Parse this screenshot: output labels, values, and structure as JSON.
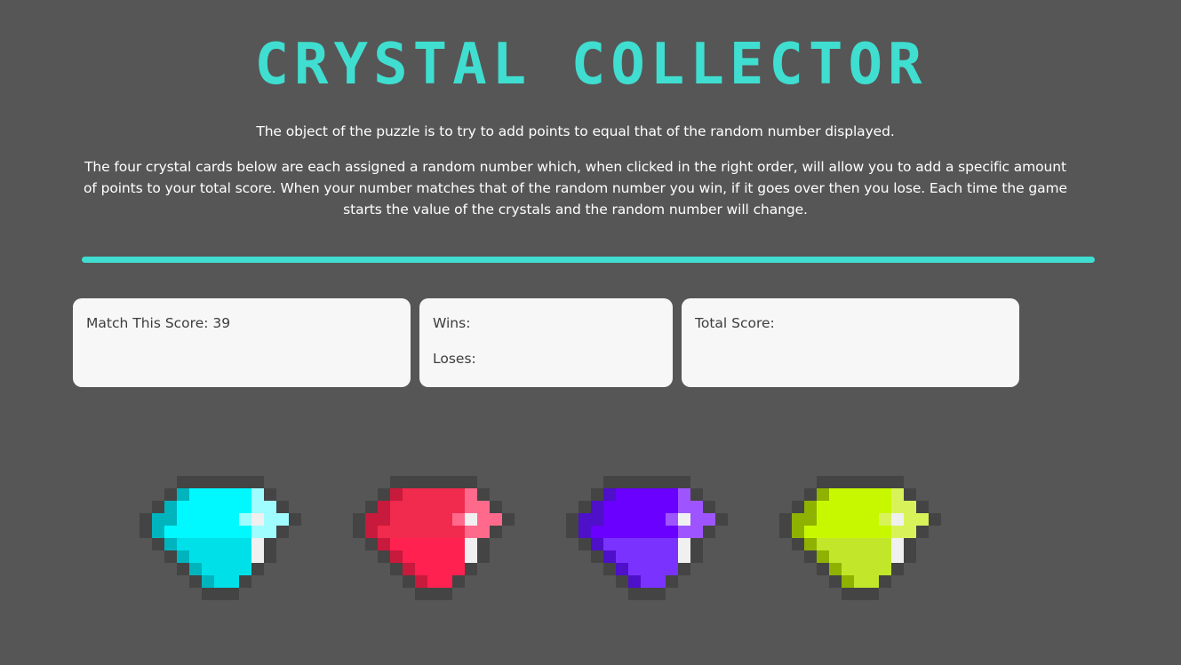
{
  "title": "CRYSTAL COLLECTOR",
  "instructions": {
    "line1": "The object of the puzzle is to try to add points to equal that of the random number displayed.",
    "line2": "The four crystal cards below are each assigned a random number which, when clicked in the right order, will allow you to add a specific amount of points to your total score. When your number matches that of the random number you win, if it goes over then you lose. Each time the game starts the value of the crystals and the random number will change."
  },
  "scoreboard": {
    "target_label": "Match This Score: 39",
    "wins_label": "Wins:",
    "losses_label": "Loses:",
    "total_label": "Total Score:"
  },
  "colors": {
    "background": "#565656",
    "accent": "#3fded0",
    "card": "#f7f7f7"
  },
  "crystals": [
    {
      "name": "cyan-crystal",
      "colors": {
        "light": "#a0fdff",
        "mid": "#00f8ff",
        "shade": "#00e0e8",
        "dark": "#00b4be"
      }
    },
    {
      "name": "red-crystal",
      "colors": {
        "light": "#ff6a8c",
        "mid": "#f02b4e",
        "shade": "#ff2150",
        "dark": "#c81a3c"
      }
    },
    {
      "name": "purple-crystal",
      "colors": {
        "light": "#9e55ff",
        "mid": "#6a00ff",
        "shade": "#7a33ff",
        "dark": "#4e10c8"
      }
    },
    {
      "name": "lime-crystal",
      "colors": {
        "light": "#d8f35a",
        "mid": "#c8f800",
        "shade": "#c2e62a",
        "dark": "#8fb100"
      }
    }
  ]
}
